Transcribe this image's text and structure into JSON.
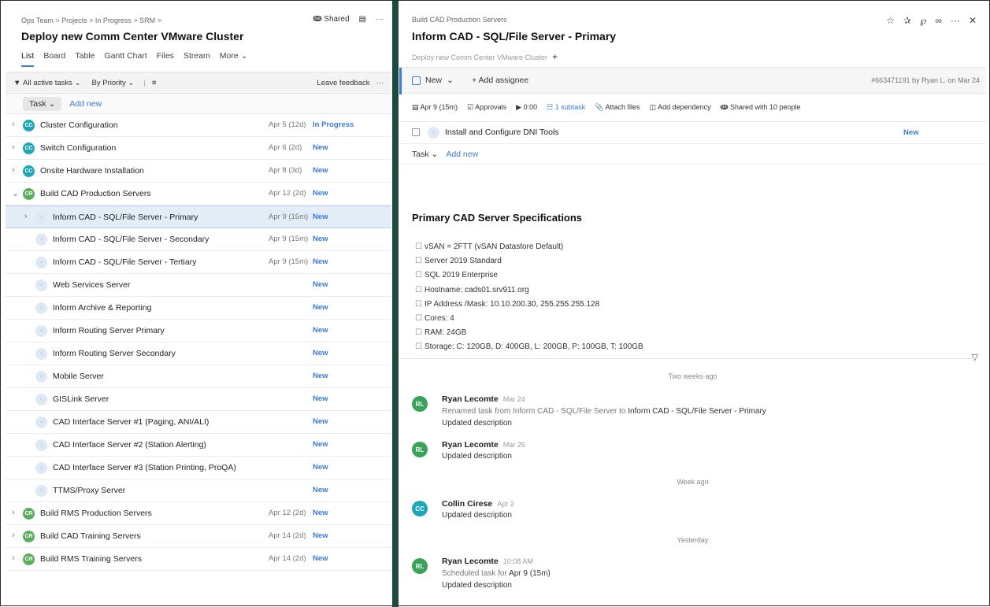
{
  "left": {
    "breadcrumb": "Ops Team > Projects > In Progress > SRM >",
    "title": "Deploy new Comm Center VMware Cluster",
    "shared_label": "Shared",
    "views": [
      "List",
      "Board",
      "Table",
      "Gantt Chart",
      "Files",
      "Stream",
      "More ⌄"
    ],
    "filter": {
      "active": "All active tasks ⌄",
      "priority": "By Priority ⌄",
      "feedback": "Leave feedback"
    },
    "task_pill": "Task ⌄",
    "add_new": "Add new",
    "tasks": [
      {
        "name": "Cluster Configuration",
        "date": "Apr 5 (12d)",
        "status": "In Progress",
        "avatar": "CC",
        "level": 0,
        "chev": true
      },
      {
        "name": "Switch Configuration",
        "date": "Apr 6 (2d)",
        "status": "New",
        "avatar": "CC",
        "level": 0,
        "chev": true
      },
      {
        "name": "Onsite Hardware Installation",
        "date": "Apr 8 (3d)",
        "status": "New",
        "avatar": "CC",
        "level": 0,
        "chev": true
      },
      {
        "name": "Build CAD Production Servers",
        "date": "Apr 12 (2d)",
        "status": "New",
        "avatar": "CR",
        "level": 0,
        "chev": true,
        "open": true
      },
      {
        "name": "Inform CAD - SQL/File Server - Primary",
        "date": "Apr 9 (15m)",
        "status": "New",
        "avatar": "",
        "level": 1,
        "chev": true,
        "selected": true
      },
      {
        "name": "Inform CAD - SQL/File Server - Secondary",
        "date": "Apr 9 (15m)",
        "status": "New",
        "avatar": "",
        "level": 1
      },
      {
        "name": "Inform CAD - SQL/File Server - Tertiary",
        "date": "Apr 9 (15m)",
        "status": "New",
        "avatar": "",
        "level": 1
      },
      {
        "name": "Web Services Server",
        "date": "",
        "status": "New",
        "avatar": "",
        "level": 1
      },
      {
        "name": "Inform Archive & Reporting",
        "date": "",
        "status": "New",
        "avatar": "",
        "level": 1
      },
      {
        "name": "Inform Routing Server Primary",
        "date": "",
        "status": "New",
        "avatar": "",
        "level": 1
      },
      {
        "name": "Inform Routing Server Secondary",
        "date": "",
        "status": "New",
        "avatar": "",
        "level": 1
      },
      {
        "name": "Mobile Server",
        "date": "",
        "status": "New",
        "avatar": "",
        "level": 1
      },
      {
        "name": "GISLink Server",
        "date": "",
        "status": "New",
        "avatar": "",
        "level": 1
      },
      {
        "name": "CAD Interface Server #1 (Paging, ANI/ALI)",
        "date": "",
        "status": "New",
        "avatar": "",
        "level": 1
      },
      {
        "name": "CAD Interface Server #2 (Station Alerting)",
        "date": "",
        "status": "New",
        "avatar": "",
        "level": 1
      },
      {
        "name": "CAD Interface Server #3 (Station Printing, ProQA)",
        "date": "",
        "status": "New",
        "avatar": "",
        "level": 1
      },
      {
        "name": "TTMS/Proxy Server",
        "date": "",
        "status": "New",
        "avatar": "",
        "level": 1
      },
      {
        "name": "Build RMS Production Servers",
        "date": "Apr 12 (2d)",
        "status": "New",
        "avatar": "CR",
        "level": 0,
        "chev": true
      },
      {
        "name": "Build CAD Training Servers",
        "date": "Apr 14 (2d)",
        "status": "New",
        "avatar": "CR",
        "level": 0,
        "chev": true
      },
      {
        "name": "Build RMS Training Servers",
        "date": "Apr 14 (2d)",
        "status": "New",
        "avatar": "CR",
        "level": 0,
        "chev": true
      }
    ]
  },
  "right": {
    "parent": "Build CAD Production Servers",
    "title": "Inform CAD - SQL/File Server - Primary",
    "project_chip": "Deploy new Comm Center VMware Cluster",
    "new_button": "New",
    "add_assignee": "+ Add assignee",
    "meta": "#663471191 by Ryan L. on Mar 24",
    "props": {
      "date": "Apr 9 (15m)",
      "approvals": "Approvals",
      "timer": "0:00",
      "subtask": "1 subtask",
      "attach": "Attach files",
      "dependency": "Add dependency",
      "shared": "Shared with 10 people"
    },
    "subtask": {
      "name": "Install and Configure DNI Tools",
      "status": "New"
    },
    "task_pill": "Task ⌄",
    "add_new": "Add new",
    "desc_title": "Primary CAD Server Specifications",
    "specs": [
      "vSAN = 2FTT (vSAN Datastore Default)",
      "Server 2019 Standard",
      "SQL 2019 Enterprise",
      "Hostname: cads01.srv911.org",
      "IP Address /Mask: 10.10.200.30, 255.255.255.128",
      "Cores: 4",
      "RAM: 24GB",
      "Storage: C: 120GB, D: 400GB, L: 200GB, P: 100GB, T: 100GB"
    ],
    "stream": {
      "sep1": "Two weeks ago",
      "a1": {
        "initials": "RL",
        "name": "Ryan Lecomte",
        "time": "Mar 24",
        "l1_pre": "Renamed task from Inform CAD - SQL/File Server to ",
        "l1_post": "Inform CAD - SQL/File Server - Primary",
        "l2": "Updated description"
      },
      "a2": {
        "initials": "RL",
        "name": "Ryan Lecomte",
        "time": "Mar 25",
        "l1": "Updated description"
      },
      "sep2": "Week ago",
      "a3": {
        "initials": "CC",
        "name": "Collin Cirese",
        "time": "Apr 2",
        "l1": "Updated description"
      },
      "sep3": "Yesterday",
      "a4": {
        "initials": "RL",
        "name": "Ryan Lecomte",
        "time": "10:08 AM",
        "l1_pre": "Scheduled task for ",
        "l1_post": "Apr 9 (15m)",
        "l2": "Updated description"
      }
    }
  }
}
